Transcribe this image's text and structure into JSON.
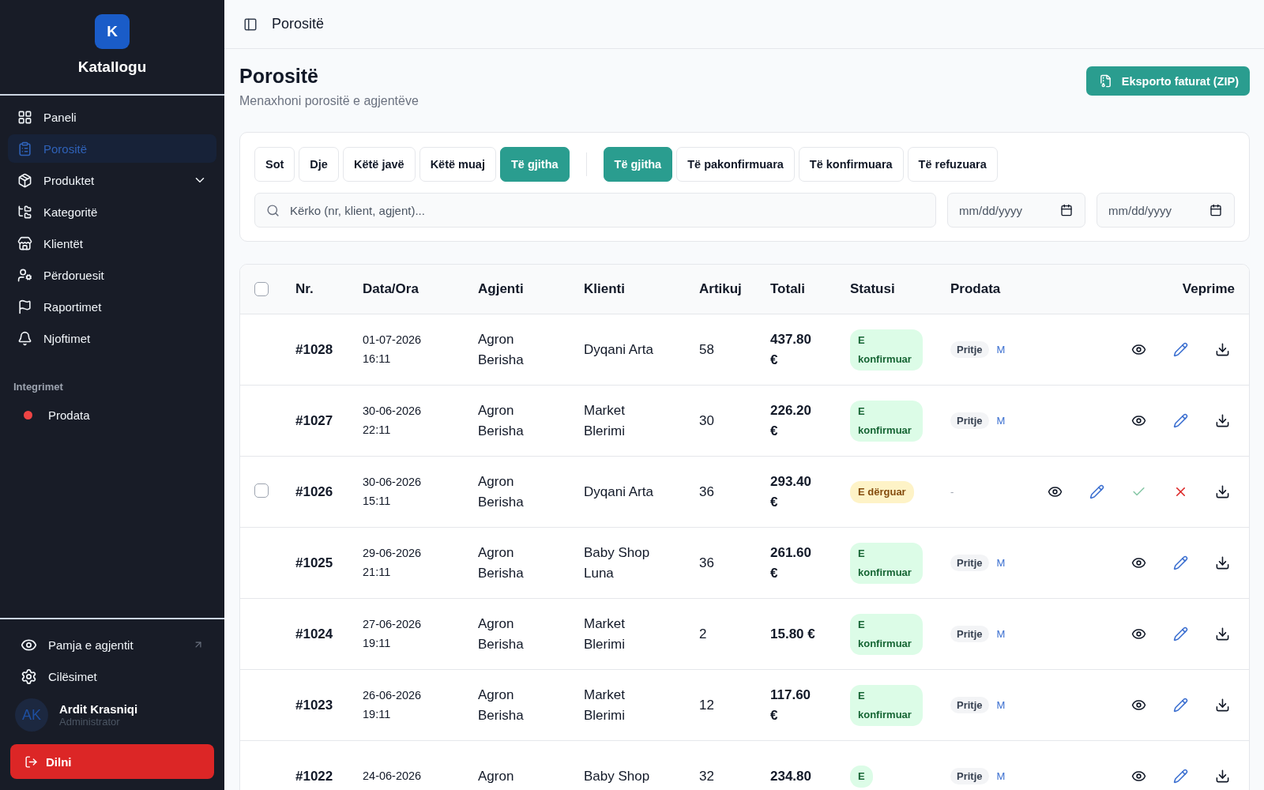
{
  "sidebar": {
    "logo_letter": "K",
    "app_name": "Katallogu",
    "items": [
      {
        "label": "Paneli",
        "selected": false,
        "expandable": false
      },
      {
        "label": "Porositë",
        "selected": true,
        "expandable": false
      },
      {
        "label": "Produktet",
        "selected": false,
        "expandable": true
      },
      {
        "label": "Kategoritë",
        "selected": false,
        "expandable": false
      },
      {
        "label": "Klientët",
        "selected": false,
        "expandable": false
      },
      {
        "label": "Përdoruesit",
        "selected": false,
        "expandable": false
      },
      {
        "label": "Raportimet",
        "selected": false,
        "expandable": false
      },
      {
        "label": "Njoftimet",
        "selected": false,
        "expandable": false
      }
    ],
    "section_label": "Integrimet",
    "integrations": [
      {
        "label": "Prodata",
        "color": "#ef4444"
      }
    ],
    "bottom_items": [
      {
        "label": "Pamja e agjentit",
        "external": true
      },
      {
        "label": "Cilësimet",
        "external": false
      }
    ],
    "user": {
      "initials": "AK",
      "name": "Ardit Krasniqi",
      "role": "Administrator"
    },
    "logout": "Dilni"
  },
  "topbar": {
    "title": "Porositë"
  },
  "page": {
    "title": "Porositë",
    "subtitle": "Menaxhoni porositë e agjentëve",
    "export_button": "Eksporto faturat (ZIP)"
  },
  "filters": {
    "period_tabs": [
      {
        "label": "Sot",
        "selected": false
      },
      {
        "label": "Dje",
        "selected": false
      },
      {
        "label": "Këtë javë",
        "selected": false
      },
      {
        "label": "Këtë muaj",
        "selected": false
      },
      {
        "label": "Të gjitha",
        "selected": true
      }
    ],
    "status_tabs": [
      {
        "label": "Të gjitha",
        "selected": true
      },
      {
        "label": "Të pakonfirmuara",
        "selected": false
      },
      {
        "label": "Të konfirmuara",
        "selected": false
      },
      {
        "label": "Të refuzuara",
        "selected": false
      }
    ],
    "search": {
      "placeholder": "Kërko (nr, klient, agjent)..."
    },
    "date_from": {
      "placeholder": "mm/dd/yyyy"
    },
    "date_to": {
      "placeholder": "mm/dd/yyyy"
    }
  },
  "table": {
    "select_all": {
      "checked": false
    },
    "columns": [
      "Nr.",
      "Data/Ora",
      "Agjenti",
      "Klienti",
      "Artikuj",
      "Totali",
      "Statusi",
      "Prodata",
      "Veprime"
    ],
    "rows": [
      {
        "number": "#1028",
        "date": "01-07-2026",
        "time": "16:11",
        "agent": "Agron Berisha",
        "client": "Dyqani Arta",
        "items": "58",
        "total": "437.80 €",
        "status": {
          "label": "E konfirmuar",
          "kind": "confirmed"
        },
        "prodata": {
          "tag": "Pritje",
          "code": "M"
        }
      },
      {
        "number": "#1027",
        "date": "30-06-2026",
        "time": "22:11",
        "agent": "Agron Berisha",
        "client": "Market Blerimi",
        "items": "30",
        "total": "226.20 €",
        "status": {
          "label": "E konfirmuar",
          "kind": "confirmed"
        },
        "prodata": {
          "tag": "Pritje",
          "code": "M"
        }
      },
      {
        "number": "#1026",
        "date": "30-06-2026",
        "time": "15:11",
        "agent": "Agron Berisha",
        "client": "Dyqani Arta",
        "items": "36",
        "total": "293.40 €",
        "status": {
          "label": "E dërguar",
          "kind": "sent"
        },
        "checkbox": {
          "checked": false
        },
        "prodata_empty": "-"
      },
      {
        "number": "#1025",
        "date": "29-06-2026",
        "time": "21:11",
        "agent": "Agron Berisha",
        "client": "Baby Shop Luna",
        "items": "36",
        "total": "261.60 €",
        "status": {
          "label": "E konfirmuar",
          "kind": "confirmed"
        },
        "prodata": {
          "tag": "Pritje",
          "code": "M"
        }
      },
      {
        "number": "#1024",
        "date": "27-06-2026",
        "time": "19:11",
        "agent": "Agron Berisha",
        "client": "Market Blerimi",
        "items": "2",
        "total": "15.80 €",
        "status": {
          "label": "E konfirmuar",
          "kind": "confirmed"
        },
        "prodata": {
          "tag": "Pritje",
          "code": "M"
        }
      },
      {
        "number": "#1023",
        "date": "26-06-2026",
        "time": "19:11",
        "agent": "Agron Berisha",
        "client": "Market Blerimi",
        "items": "12",
        "total": "117.60 €",
        "status": {
          "label": "E konfirmuar",
          "kind": "confirmed"
        },
        "prodata": {
          "tag": "Pritje",
          "code": "M"
        }
      },
      {
        "number": "#1022",
        "date": "24-06-2026",
        "agent": "Agron",
        "client": "Baby Shop",
        "items": "32",
        "total": "234.80",
        "status": {
          "label": "E",
          "kind": "confirmed"
        },
        "prodata": {
          "tag": "Pritje",
          "code": "M"
        }
      }
    ]
  }
}
